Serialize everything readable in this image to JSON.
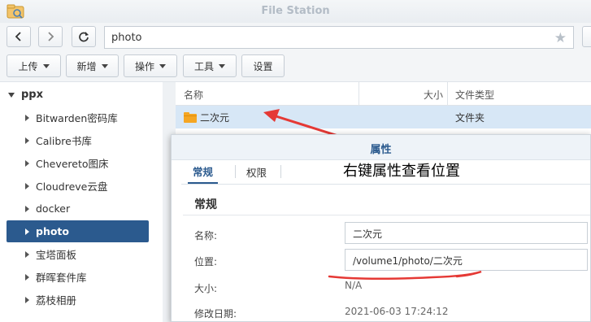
{
  "window": {
    "title": "File Station"
  },
  "nav": {
    "path_value": "photo",
    "icons": [
      "chevron-left-icon",
      "chevron-right-icon",
      "refresh-icon",
      "star-icon"
    ]
  },
  "toolbar": {
    "upload": "上传",
    "new": "新增",
    "action": "操作",
    "tools": "工具",
    "settings": "设置"
  },
  "sidebar": {
    "root": "ppx",
    "items": [
      {
        "label": "Bitwarden密码库"
      },
      {
        "label": "Calibre书库"
      },
      {
        "label": "Chevereto图床"
      },
      {
        "label": "Cloudreve云盘"
      },
      {
        "label": "docker"
      },
      {
        "label": "photo"
      },
      {
        "label": "宝塔面板"
      },
      {
        "label": "群晖套件库"
      },
      {
        "label": "荔枝相册"
      }
    ],
    "active_index": 5
  },
  "file_list": {
    "columns": {
      "name": "名称",
      "size": "大小",
      "type": "文件类型"
    },
    "rows": [
      {
        "name": "二次元",
        "size": "",
        "type": "文件夹"
      }
    ]
  },
  "annotation": {
    "text": "右键属性查看位置",
    "color": "#e53935"
  },
  "properties_dialog": {
    "title": "属性",
    "tabs": [
      "常规",
      "权限"
    ],
    "active_tab": 0,
    "section": "常规",
    "fields": {
      "name_label": "名称:",
      "name_value": "二次元",
      "location_label": "位置:",
      "location_value": "/volume1/photo/二次元",
      "size_label": "大小:",
      "size_value": "N/A",
      "modified_label": "修改日期:",
      "modified_value": "2021-06-03 17:24:12"
    }
  },
  "colors": {
    "accent": "#2b5a8e",
    "selection": "#d7e7f6",
    "folder": "#f5a623"
  }
}
